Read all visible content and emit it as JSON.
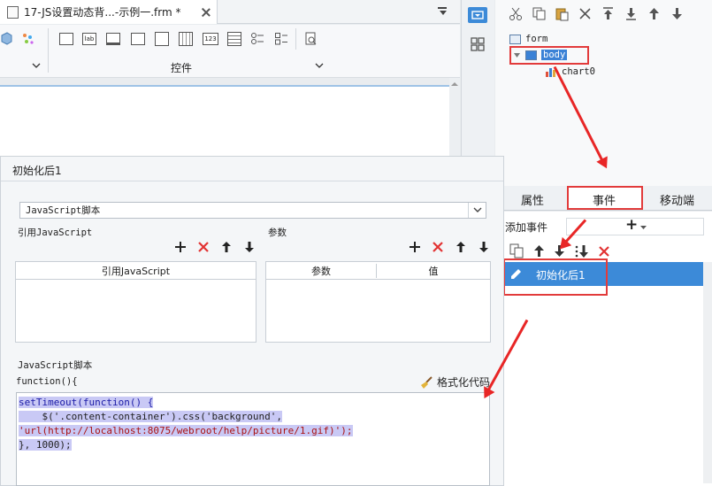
{
  "editor": {
    "tab_title": "17-JS设置动态背...-示例一.frm *",
    "controls_label": "控件"
  },
  "tree": {
    "form_label": "form",
    "body_label": "body",
    "chart_label": "chart0"
  },
  "event_panel": {
    "tabs": [
      "属性",
      "事件",
      "移动端"
    ],
    "add_event_label": "添加事件",
    "add_event_symbol": "+",
    "selected_event": "初始化后1"
  },
  "dialog": {
    "title": "初始化后1",
    "script_type": "JavaScript脚本",
    "ref_js_label": "引用JavaScript",
    "params_label": "参数",
    "ref_js_column": "引用JavaScript",
    "param_columns": [
      "参数",
      "值"
    ],
    "script_section_label": "JavaScript脚本",
    "function_signature": "function(){",
    "format_button": "格式化代码",
    "code_lines": [
      "setTimeout(function() {",
      "    $('.content-container').css('background',",
      "'url(http://localhost:8075/webroot/help/picture/1.gif)');",
      "}, 1000);"
    ]
  },
  "colors": {
    "accent": "#3c8ad8",
    "highlight": "#e23b3b",
    "code_selection": "#c9c9f5"
  }
}
